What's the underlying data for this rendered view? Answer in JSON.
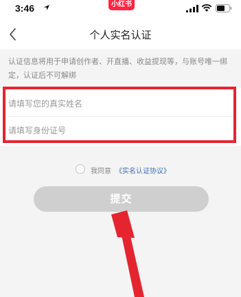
{
  "status_bar": {
    "time": "3:46",
    "brand_badge": "小红书"
  },
  "nav": {
    "title": "个人实名认证"
  },
  "notice": {
    "text": "认证信息将用于申请创作者、开直播、收益提现等，与账号唯一绑定，认证后不可解绑"
  },
  "form": {
    "name_placeholder": "请填写您的真实姓名",
    "name_value": "",
    "id_placeholder": "请填写身份证号",
    "id_value": ""
  },
  "agreement": {
    "prefix": "我同意",
    "link": "《实名认证协议》",
    "checked": false
  },
  "submit": {
    "label": "提交"
  },
  "colors": {
    "brand": "#ff2442",
    "highlight": "#e4252f",
    "button_disabled": "#cfcfcf",
    "link": "#3f6fb6"
  }
}
